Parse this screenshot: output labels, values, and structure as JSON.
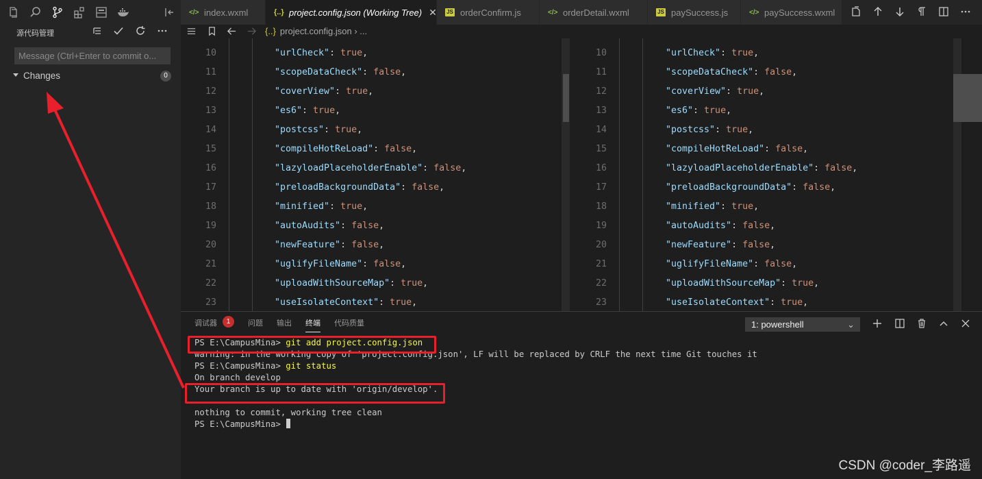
{
  "colors": {
    "accent": "#007acc",
    "json_key": "#9cdcfe",
    "json_bool": "#ce9178",
    "terminal_command": "#f5f543",
    "annotation_red": "#e8202c",
    "badge_red": "#c72e2e"
  },
  "activity_bar": {
    "icons": [
      "files-icon",
      "search-icon",
      "source-control-icon",
      "extensions-icon",
      "remote-explorer-icon",
      "docker-icon",
      "panel-toggle-icon"
    ]
  },
  "sidebar": {
    "title": "源代码管理",
    "toolbar_icons": [
      "view-as-tree-icon",
      "commit-check-icon",
      "refresh-icon",
      "more-icon"
    ],
    "commit_placeholder": "Message (Ctrl+Enter to commit o...",
    "changes_label": "Changes",
    "changes_count": "0"
  },
  "tabs": [
    {
      "label": "index.wxml",
      "icon": "wxml-icon",
      "icon_glyph": "</>",
      "active": false
    },
    {
      "label": "project.config.json (Working Tree)",
      "icon": "json-icon",
      "icon_glyph": "{..}",
      "active": true,
      "close": "✕"
    },
    {
      "label": "orderConfirm.js",
      "icon": "js-icon",
      "icon_glyph": "JS",
      "active": false
    },
    {
      "label": "orderDetail.wxml",
      "icon": "wxml-icon",
      "icon_glyph": "</>",
      "active": false
    },
    {
      "label": "paySuccess.js",
      "icon": "js-icon",
      "icon_glyph": "JS",
      "active": false
    },
    {
      "label": "paySuccess.wxml",
      "icon": "wxml-icon",
      "icon_glyph": "</>",
      "active": false
    }
  ],
  "editor_actions": [
    "open-changes-icon",
    "previous-change-icon",
    "next-change-icon",
    "whitespace-icon",
    "split-editor-icon",
    "more-icon"
  ],
  "breadcrumb": {
    "json_glyph": "{..}",
    "path": "project.config.json",
    "separator": "›",
    "ellipsis": "..."
  },
  "editor": {
    "lines": [
      {
        "num": "10",
        "key": "\"urlCheck\"",
        "value": "true"
      },
      {
        "num": "11",
        "key": "\"scopeDataCheck\"",
        "value": "false"
      },
      {
        "num": "12",
        "key": "\"coverView\"",
        "value": "true"
      },
      {
        "num": "13",
        "key": "\"es6\"",
        "value": "true"
      },
      {
        "num": "14",
        "key": "\"postcss\"",
        "value": "true"
      },
      {
        "num": "15",
        "key": "\"compileHotReLoad\"",
        "value": "false"
      },
      {
        "num": "16",
        "key": "\"lazyloadPlaceholderEnable\"",
        "value": "false"
      },
      {
        "num": "17",
        "key": "\"preloadBackgroundData\"",
        "value": "false"
      },
      {
        "num": "18",
        "key": "\"minified\"",
        "value": "true"
      },
      {
        "num": "19",
        "key": "\"autoAudits\"",
        "value": "false"
      },
      {
        "num": "20",
        "key": "\"newFeature\"",
        "value": "false"
      },
      {
        "num": "21",
        "key": "\"uglifyFileName\"",
        "value": "false"
      },
      {
        "num": "22",
        "key": "\"uploadWithSourceMap\"",
        "value": "true"
      },
      {
        "num": "23",
        "key": "\"useIsolateContext\"",
        "value": "true"
      }
    ]
  },
  "panel": {
    "tabs": [
      "调试器",
      "问题",
      "输出",
      "终端",
      "代码质量"
    ],
    "active_tab": "终端",
    "debugger_badge": "1",
    "terminal_select": "1: powershell",
    "actions": [
      "add-terminal-icon",
      "split-terminal-icon",
      "kill-terminal-icon",
      "maximize-panel-icon",
      "close-panel-icon"
    ]
  },
  "terminal": {
    "lines": [
      {
        "prompt": "PS E:\\CampusMina> ",
        "command": "git add project.config.json",
        "text": ""
      },
      {
        "prompt": "",
        "command": "",
        "text": "warning: in the working copy of 'project.config.json', LF will be replaced by CRLF the next time Git touches it"
      },
      {
        "prompt": "PS E:\\CampusMina> ",
        "command": "git status",
        "text": ""
      },
      {
        "prompt": "",
        "command": "",
        "text": "On branch develop"
      },
      {
        "prompt": "",
        "command": "",
        "text": "Your branch is up to date with 'origin/develop'."
      },
      {
        "prompt": "",
        "command": "",
        "text": ""
      },
      {
        "prompt": "",
        "command": "",
        "text": "nothing to commit, working tree clean"
      },
      {
        "prompt": "PS E:\\CampusMina> ",
        "command": "",
        "text": "",
        "cursor": true
      }
    ]
  },
  "watermark": "CSDN @coder_李路遥"
}
